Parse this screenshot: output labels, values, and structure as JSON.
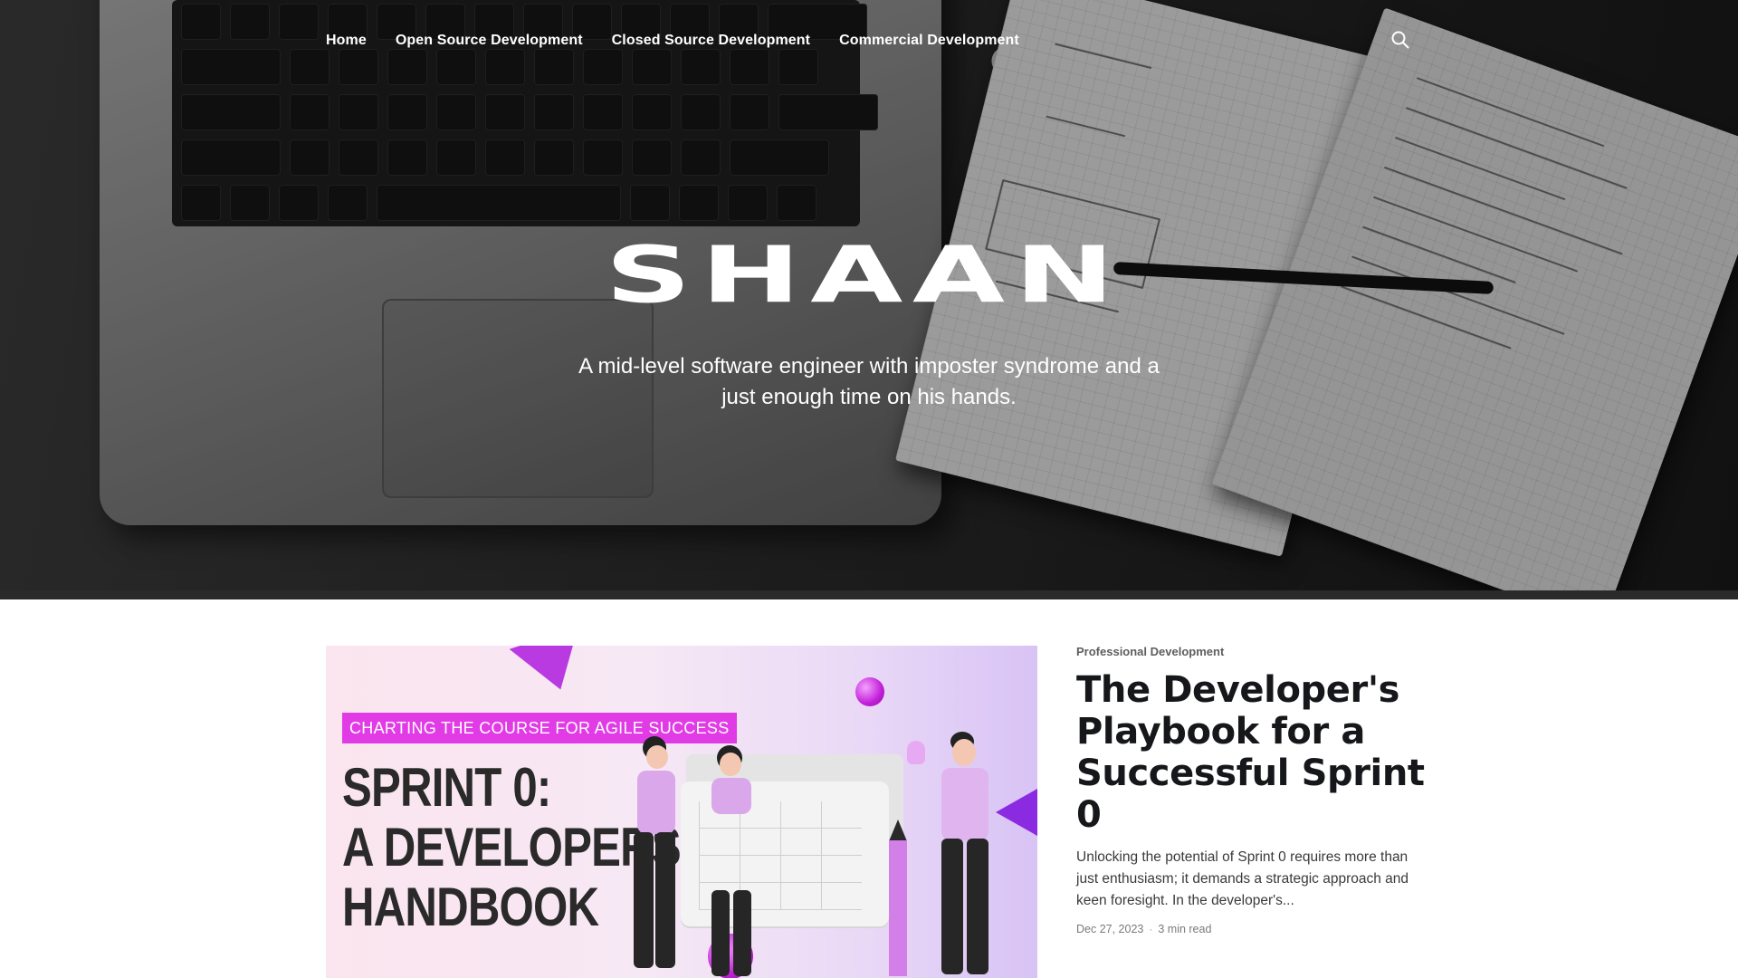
{
  "nav": {
    "items": [
      {
        "label": "Home"
      },
      {
        "label": "Open Source Development"
      },
      {
        "label": "Closed Source Development"
      },
      {
        "label": "Commercial Development"
      }
    ],
    "search_icon": "search-icon"
  },
  "hero": {
    "logo": "SHAAN",
    "tagline": "A mid-level software engineer with imposter syndrome and a just enough time on his hands."
  },
  "featured_post": {
    "image": {
      "kicker": "CHARTING THE COURSE FOR AGILE SUCCESS",
      "title_line1": "SPRINT 0:",
      "title_line2": "A DEVELOPERS",
      "title_line3": "HANDBOOK",
      "accent_color": "#e13be6"
    },
    "tag": "Professional Development",
    "title": "The Developer's Playbook for a Successful Sprint 0",
    "excerpt": "Unlocking the potential of Sprint 0 requires more than just enthusiasm; it demands a strategic approach and keen foresight. In the developer's...",
    "date": "Dec 27, 2023",
    "read_time": "3 min read"
  }
}
